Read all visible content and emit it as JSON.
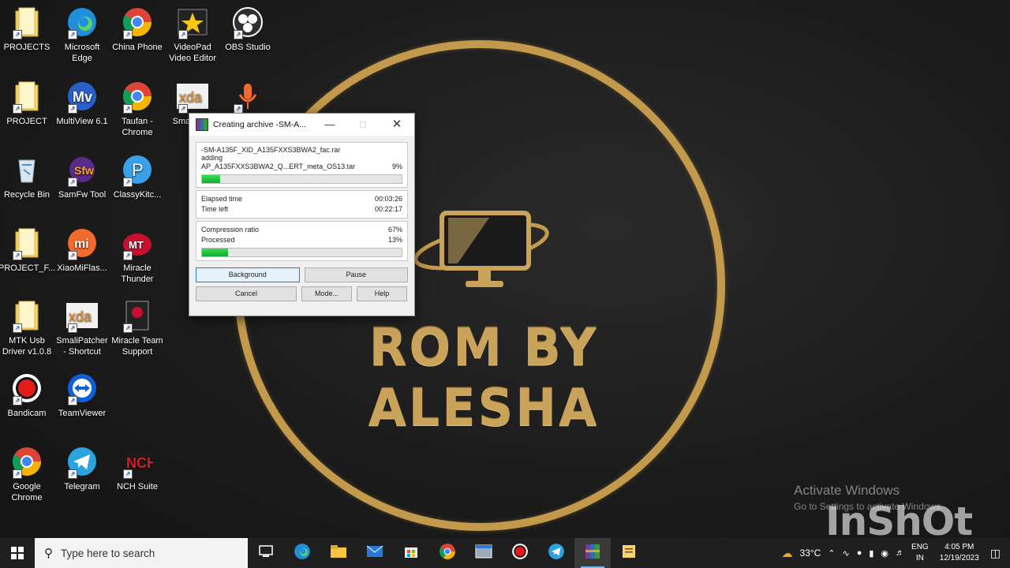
{
  "desktop_icons": [
    {
      "label": "PROJECTS",
      "icon": "folder-icon"
    },
    {
      "label": "Microsoft Edge",
      "icon": "edge-icon"
    },
    {
      "label": "China Phone",
      "icon": "chrome-icon"
    },
    {
      "label": "VideoPad Video Editor",
      "icon": "videopad-icon"
    },
    {
      "label": "OBS Studio",
      "icon": "obs-icon"
    },
    {
      "label": "PROJECT",
      "icon": "folder-icon"
    },
    {
      "label": "MultiView 6.1",
      "icon": "multiview-icon"
    },
    {
      "label": "Taufan - Chrome",
      "icon": "chrome-icon"
    },
    {
      "label": "Smali - Sh",
      "icon": "xda-icon"
    },
    {
      "label": "",
      "icon": "microphone-icon"
    },
    {
      "label": "Recycle Bin",
      "icon": "recycle-bin-icon"
    },
    {
      "label": "SamFw Tool",
      "icon": "samfw-icon"
    },
    {
      "label": "ClassyKitc...",
      "icon": "classykitchen-icon"
    },
    {
      "label": "PROJECT_F...",
      "icon": "folder-icon"
    },
    {
      "label": "XiaoMiFlas...",
      "icon": "xiaomi-icon"
    },
    {
      "label": "Miracle Thunder",
      "icon": "miracle-icon"
    },
    {
      "label": "MTK Usb Driver v1.0.8",
      "icon": "folder-icon"
    },
    {
      "label": "SmaliPatcher - Shortcut",
      "icon": "xda-icon"
    },
    {
      "label": "Miracle Team Support",
      "icon": "miracle-team-icon"
    },
    {
      "label": "Bandicam",
      "icon": "bandicam-icon"
    },
    {
      "label": "TeamViewer",
      "icon": "teamviewer-icon"
    },
    {
      "label": "Google Chrome",
      "icon": "chrome-icon"
    },
    {
      "label": "Telegram",
      "icon": "telegram-icon"
    },
    {
      "label": "NCH Suite",
      "icon": "nch-icon"
    }
  ],
  "wallpaper": {
    "text": "ROM BY ALESHA",
    "accent": "#c39a4c"
  },
  "dialog": {
    "title": "Creating archive -SM-A...",
    "archive_name": "-SM-A135F_XID_A135FXXS3BWA2_fac.rar",
    "action": "adding",
    "current_file": "AP_A135FXXS3BWA2_Q...ERT_meta_OS13.tar",
    "file_percent": "9%",
    "file_progress": 0.09,
    "elapsed_label": "Elapsed time",
    "elapsed_value": "00:03:26",
    "time_left_label": "Time left",
    "time_left_value": "00:22:17",
    "ratio_label": "Compression ratio",
    "ratio_value": "67%",
    "processed_label": "Processed",
    "processed_value": "13%",
    "processed_progress": 0.13,
    "buttons": {
      "background": "Background",
      "pause": "Pause",
      "cancel": "Cancel",
      "mode": "Mode...",
      "help": "Help"
    }
  },
  "watermarks": {
    "activate_title": "Activate Windows",
    "activate_sub": "Go to Settings to activate Windows.",
    "inshot": "InShOt"
  },
  "taskbar": {
    "search_placeholder": "Type here to search",
    "apps": [
      "task-view-icon",
      "edge-icon",
      "file-explorer-icon",
      "mail-icon",
      "store-icon",
      "chrome-icon",
      "window-icon",
      "bandicam-icon",
      "telegram-icon",
      "winrar-icon",
      "notepad-icon"
    ],
    "weather": "33°C",
    "language_1": "ENG",
    "language_2": "IN",
    "time": "4:05 PM",
    "date": "12/19/2023"
  }
}
